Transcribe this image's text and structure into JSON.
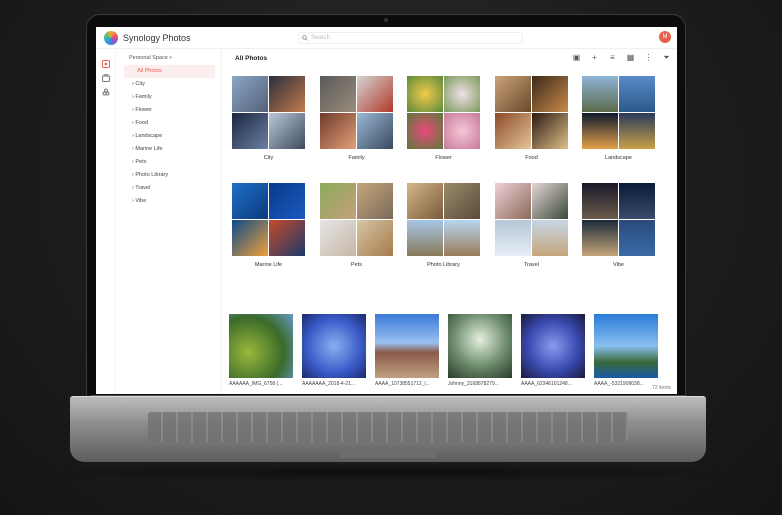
{
  "app": {
    "title": "Synology Photos",
    "avatar_initial": "M"
  },
  "search": {
    "placeholder": "Search"
  },
  "sidebar": {
    "space_label": "Personal Space",
    "items": [
      {
        "label": "All Photos"
      },
      {
        "label": "City"
      },
      {
        "label": "Family"
      },
      {
        "label": "Flower"
      },
      {
        "label": "Food"
      },
      {
        "label": "Landscape"
      },
      {
        "label": "Marine Life"
      },
      {
        "label": "Pets"
      },
      {
        "label": "Photo Library"
      },
      {
        "label": "Travel"
      },
      {
        "label": "Vibe"
      }
    ]
  },
  "main": {
    "title": "All Photos",
    "item_count": "72 items"
  },
  "albums": [
    {
      "name": "City"
    },
    {
      "name": "Family"
    },
    {
      "name": "Flower"
    },
    {
      "name": "Food"
    },
    {
      "name": "Landscape"
    },
    {
      "name": "Marine Life"
    },
    {
      "name": "Pets"
    },
    {
      "name": "Photo Library"
    },
    {
      "name": "Travel"
    },
    {
      "name": "Vibe"
    }
  ],
  "photos": [
    {
      "caption": "AAAAAA_IMG_6758 (..."
    },
    {
      "caption": "AAAAAAA_2018-4-21..."
    },
    {
      "caption": "AAAA_10738551712_l..."
    },
    {
      "caption": "Johnny_3168878279..."
    },
    {
      "caption": "AAAA_62346101248..."
    },
    {
      "caption": "AAAA_-5321909038..."
    }
  ],
  "colors": {
    "accent": "#e8604c",
    "active_bg": "#fdeeee"
  }
}
